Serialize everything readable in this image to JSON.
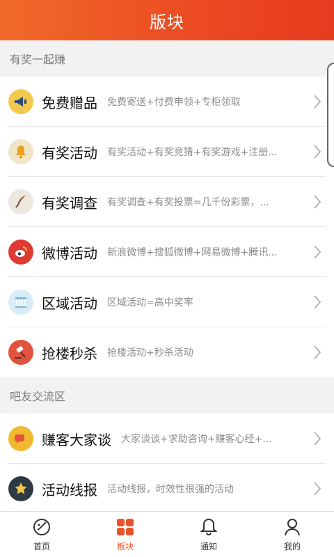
{
  "header": {
    "title": "版块"
  },
  "sections": [
    {
      "title": "有奖一起赚",
      "items": [
        {
          "title": "免费赠品",
          "desc": "免费寄送+付费申领+专柜领取",
          "icon": "megaphone-icon"
        },
        {
          "title": "有奖活动",
          "desc": "有奖活动+有奖竞猜+有奖游戏+注册...",
          "icon": "bell-icon"
        },
        {
          "title": "有奖调查",
          "desc": "有奖调查+有奖投票=几千份彩票，...",
          "icon": "quill-icon"
        },
        {
          "title": "微博活动",
          "desc": "新浪微博+搜狐微博+网易微博+腾讯...",
          "icon": "weibo-icon"
        },
        {
          "title": "区域活动",
          "desc": "区域活动=高中奖率",
          "icon": "building-icon"
        },
        {
          "title": "抢楼秒杀",
          "desc": "抢楼活动+秒杀活动",
          "icon": "gavel-icon"
        }
      ]
    },
    {
      "title": "吧友交流区",
      "items": [
        {
          "title": "赚客大家谈",
          "desc": "大家谈谈+求助咨询+赚客心经+...",
          "icon": "chat-icon"
        },
        {
          "title": "活动线报",
          "desc": "活动线报，时效性很强的活动",
          "icon": "star-icon"
        }
      ]
    }
  ],
  "tabbar": [
    {
      "label": "首页",
      "icon": "home-icon",
      "active": false
    },
    {
      "label": "板块",
      "icon": "grid-icon",
      "active": true
    },
    {
      "label": "通知",
      "icon": "bell-outline-icon",
      "active": false
    },
    {
      "label": "我的",
      "icon": "user-icon",
      "active": false
    }
  ],
  "colors": {
    "accent": "#e8542a",
    "header_start": "#f06a2a",
    "header_end": "#e73a1f"
  }
}
